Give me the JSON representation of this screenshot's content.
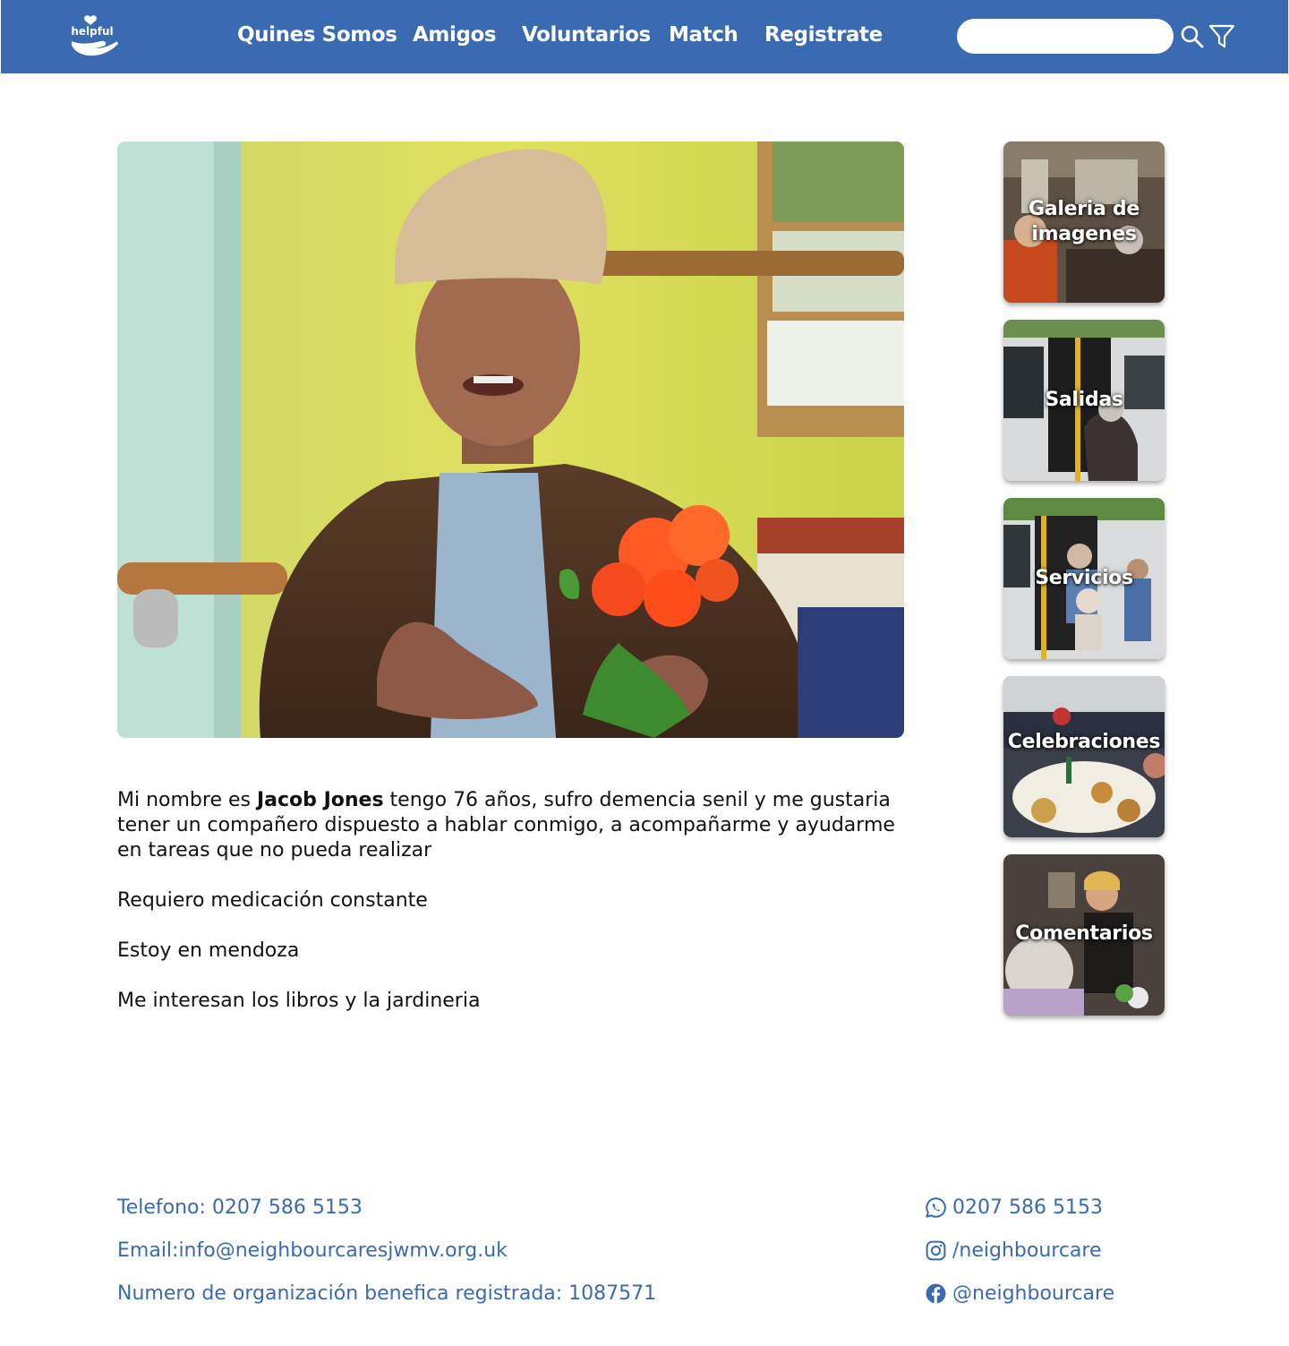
{
  "brand": {
    "logo_text": "helpful"
  },
  "nav": {
    "items": [
      "Quines Somos",
      "Amigos",
      "Voluntarios",
      "Match",
      "Registrate"
    ],
    "search": {
      "placeholder": "",
      "value": ""
    },
    "search_icon": "search-icon",
    "filter_icon": "filter-icon"
  },
  "profile": {
    "photo_alt": "Jacob Jones",
    "bio": {
      "intro_before": "Mi nombre es ",
      "name": "Jacob Jones",
      "intro_after": " tengo 76 años, sufro demencia senil y me gustaria tener un compañero dispuesto a hablar conmigo, a acompañarme y ayudarme en tareas que no pueda realizar",
      "medication": "Requiero medicación constante",
      "location": "Estoy en mendoza",
      "interests": "Me interesan los libros y la jardineria"
    }
  },
  "sidebar": {
    "cards": [
      {
        "label": "Galeria de imagenes"
      },
      {
        "label": "Salidas"
      },
      {
        "label": "Servicios"
      },
      {
        "label": "Celebraciones"
      },
      {
        "label": "Comentarios"
      }
    ]
  },
  "footer": {
    "phone": "Telefono: 0207 586 5153",
    "email": "Email:info@neighbourcaresjwmv.org.uk",
    "charity": "Numero de organización benefica registrada: 1087571",
    "social": {
      "whatsapp": "0207 586 5153",
      "instagram": "/neighbourcare",
      "facebook": "@neighbourcare"
    }
  },
  "colors": {
    "primary": "#3a6ab1",
    "text": "#111111",
    "background": "#ffffff"
  }
}
